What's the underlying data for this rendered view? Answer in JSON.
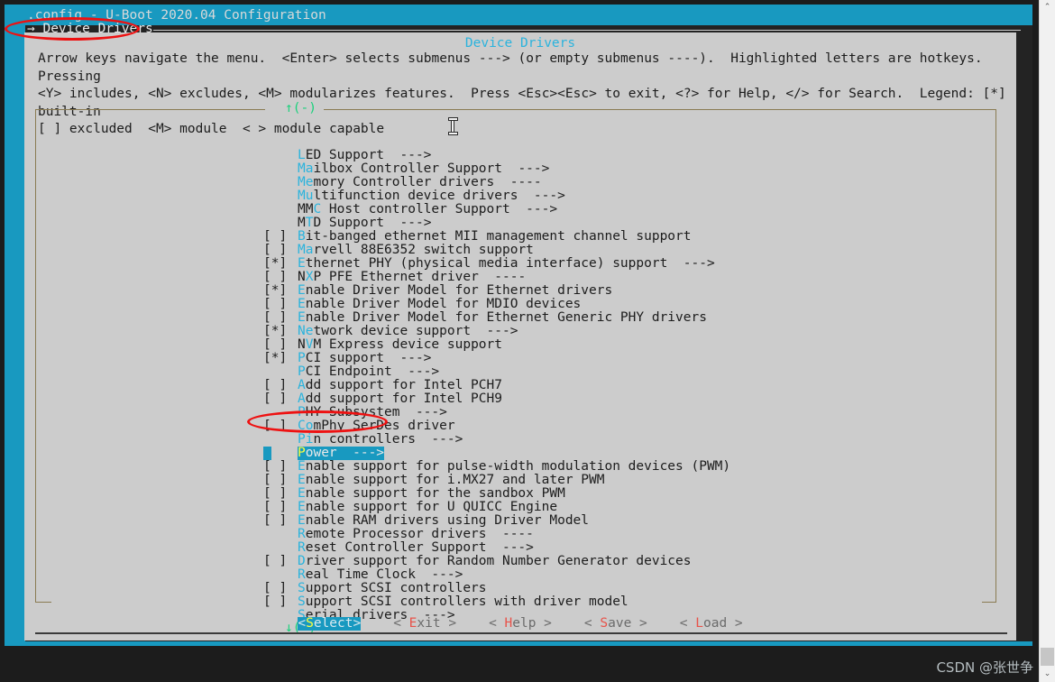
{
  "window": {
    "title": ".config - U-Boot 2020.04 Configuration",
    "breadcrumb": "→ Device Drivers",
    "dialog_title": "Device Drivers",
    "help_text": "Arrow keys navigate the menu.  <Enter> selects submenus ---> (or empty submenus ----).  Highlighted letters are hotkeys.  Pressing\n<Y> includes, <N> excludes, <M> modularizes features.  Press <Esc><Esc> to exit, <?> for Help, </> for Search.  Legend: [*] built-in\n[ ] excluded  <M> module  < > module capable",
    "scroll_up": "↑(-)",
    "scroll_down": "↓(+)",
    "watermark": "CSDN @张世争"
  },
  "colors": {
    "frame_teal": "#1899c0",
    "dialog_grey": "#cccccc",
    "hotkey_cyan": "#2ab3dd",
    "hotkey_selected_yellow": "#ffff3b",
    "scroll_green": "#1ad17c",
    "button_hotkey_red": "#e8534a",
    "annotation_red": "#ee1111",
    "terminal_black": "#1c1c1c"
  },
  "menu": {
    "items": [
      {
        "mark": "    ",
        "hot": "L",
        "rest": "ED Support  --->",
        "selected": false
      },
      {
        "mark": "    ",
        "hot": "Ma",
        "rest": "ilbox Controller Support  --->",
        "selected": false
      },
      {
        "mark": "    ",
        "hot": "Me",
        "rest": "mory Controller drivers  ----",
        "selected": false
      },
      {
        "mark": "    ",
        "hot": "Mu",
        "rest": "ltifunction device drivers  --->",
        "selected": false
      },
      {
        "mark": "    ",
        "hot": "MMC",
        "rest": " Host controller Support  --->",
        "selected": false,
        "hot_index": 2
      },
      {
        "mark": "    ",
        "hot": "MTD",
        "rest": " Support  --->",
        "selected": false,
        "hot_index": 1
      },
      {
        "mark": "[ ] ",
        "hot": "B",
        "rest": "it-banged ethernet MII management channel support",
        "selected": false
      },
      {
        "mark": "[ ] ",
        "hot": "Ma",
        "rest": "rvell 88E6352 switch support",
        "selected": false
      },
      {
        "mark": "[*] ",
        "hot": "E",
        "rest": "thernet PHY (physical media interface) support  --->",
        "selected": false
      },
      {
        "mark": "[ ] ",
        "hot": "NXP",
        "rest": " PFE Ethernet driver  ----",
        "selected": false,
        "hot_index": 1
      },
      {
        "mark": "[*] ",
        "hot": "E",
        "rest": "nable Driver Model for Ethernet drivers",
        "selected": false
      },
      {
        "mark": "[ ]   ",
        "hot": "E",
        "rest": "nable Driver Model for MDIO devices",
        "selected": false
      },
      {
        "mark": "[ ] ",
        "hot": "E",
        "rest": "nable Driver Model for Ethernet Generic PHY drivers",
        "selected": false
      },
      {
        "mark": "[*] ",
        "hot": "Ne",
        "rest": "twork device support  --->",
        "selected": false
      },
      {
        "mark": "[ ] ",
        "hot": "NVM",
        "rest": " Express device support",
        "selected": false,
        "hot_index": 1
      },
      {
        "mark": "[*] ",
        "hot": "P",
        "rest": "CI support  --->",
        "selected": false
      },
      {
        "mark": "    ",
        "hot": "P",
        "rest": "CI Endpoint  --->",
        "selected": false
      },
      {
        "mark": "[ ] ",
        "hot": "A",
        "rest": "dd support for Intel PCH7",
        "selected": false
      },
      {
        "mark": "[ ] ",
        "hot": "A",
        "rest": "dd support for Intel PCH9",
        "selected": false
      },
      {
        "mark": "    ",
        "hot": "P",
        "rest": "HY Subsystem  --->",
        "selected": false
      },
      {
        "mark": "[ ] ",
        "hot": "Co",
        "rest": "mPhy SerDes driver",
        "selected": false
      },
      {
        "mark": "    ",
        "hot": "Pi",
        "rest": "n controllers  --->",
        "selected": false
      },
      {
        "mark": "    ",
        "hot": "P",
        "rest": "ower  --->",
        "selected": true
      },
      {
        "mark": "[ ] ",
        "hot": "E",
        "rest": "nable support for pulse-width modulation devices (PWM)",
        "selected": false
      },
      {
        "mark": "[ ] ",
        "hot": "E",
        "rest": "nable support for i.MX27 and later PWM",
        "selected": false
      },
      {
        "mark": "[ ] ",
        "hot": "E",
        "rest": "nable support for the sandbox PWM",
        "selected": false
      },
      {
        "mark": "[ ] ",
        "hot": "E",
        "rest": "nable support for U QUICC Engine",
        "selected": false
      },
      {
        "mark": "[ ] ",
        "hot": "E",
        "rest": "nable RAM drivers using Driver Model",
        "selected": false
      },
      {
        "mark": "    ",
        "hot": "R",
        "rest": "emote Processor drivers  ----",
        "selected": false
      },
      {
        "mark": "    ",
        "hot": "R",
        "rest": "eset Controller Support  --->",
        "selected": false
      },
      {
        "mark": "[ ] ",
        "hot": "D",
        "rest": "river support for Random Number Generator devices",
        "selected": false
      },
      {
        "mark": "    ",
        "hot": "R",
        "rest": "eal Time Clock  --->",
        "selected": false
      },
      {
        "mark": "[ ] ",
        "hot": "S",
        "rest": "upport SCSI controllers",
        "selected": false
      },
      {
        "mark": "[ ] ",
        "hot": "S",
        "rest": "upport SCSI controllers with driver model",
        "selected": false
      },
      {
        "mark": "    ",
        "hot": "S",
        "rest": "erial drivers  --->",
        "selected": false
      }
    ]
  },
  "buttons": [
    {
      "pre": "<",
      "hot": "S",
      "post": "elect>",
      "active": true
    },
    {
      "pre": "< ",
      "hot": "E",
      "post": "xit >",
      "active": false
    },
    {
      "pre": "< ",
      "hot": "H",
      "post": "elp >",
      "active": false
    },
    {
      "pre": "< ",
      "hot": "S",
      "post": "ave >",
      "active": false
    },
    {
      "pre": "< ",
      "hot": "L",
      "post": "oad >",
      "active": false
    }
  ],
  "scrollbar": {
    "up_arrow": "⌃",
    "down_arrow": "⌄"
  }
}
